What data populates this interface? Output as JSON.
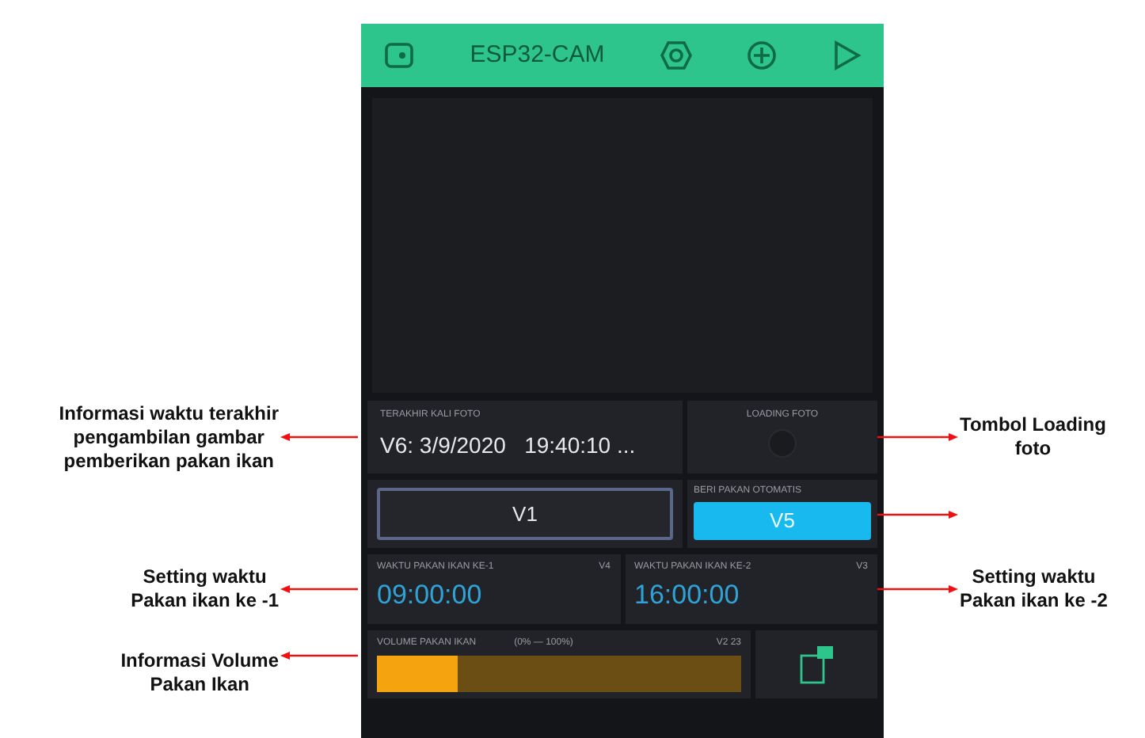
{
  "header": {
    "title": "ESP32-CAM"
  },
  "last_photo": {
    "label": "TERAKHIR KALI FOTO",
    "value": "V6: 3/9/2020   19:40:10 ..."
  },
  "loading_photo": {
    "label": "LOADING FOTO"
  },
  "button_v1": {
    "label": "V1"
  },
  "auto_feed": {
    "label": "BERI PAKAN OTOMATIS",
    "button": "V5",
    "on": true
  },
  "feed_times": [
    {
      "label": "WAKTU PAKAN IKAN KE-1",
      "pin": "V4",
      "value": "09:00:00"
    },
    {
      "label": "WAKTU PAKAN IKAN KE-2",
      "pin": "V3",
      "value": "16:00:00"
    }
  ],
  "volume": {
    "label": "VOLUME PAKAN IKAN",
    "range": "(0% — 100%)",
    "pin": "V2 23",
    "level": 0.22
  },
  "left_annotations": [
    {
      "kind": "note",
      "lines": [
        "Informasi waktu terakhir",
        "pengambilan gambar",
        "pemberikan pakan ikan"
      ]
    },
    {
      "kind": "note",
      "lines": [
        "Setting waktu",
        "Pakan ikan ke -1"
      ]
    },
    {
      "kind": "note",
      "lines": [
        "Informasi Volume",
        "Pakan Ikan"
      ]
    }
  ],
  "right_annotations": [
    {
      "kind": "note",
      "lines": [
        "Tombol Loading",
        "foto"
      ]
    },
    {
      "kind": "arrow"
    },
    {
      "kind": "note",
      "lines": [
        "Setting waktu",
        "Pakan ikan ke -2"
      ]
    }
  ]
}
